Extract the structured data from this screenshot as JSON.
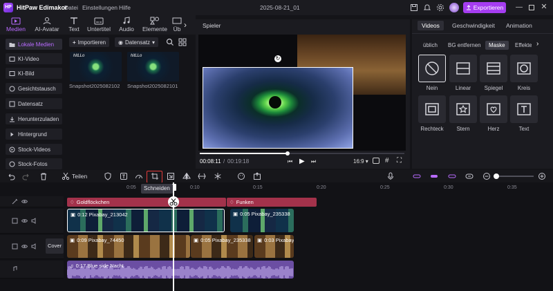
{
  "app": {
    "name": "HitPaw Edimakor",
    "logo_text": "HP",
    "project": "2025-08-21_01",
    "menus": [
      "Datei",
      "Einstellungen",
      "Hilfe"
    ],
    "export_label": "Exportieren",
    "accent": "#a53df0"
  },
  "top_tabs": [
    {
      "label": "Medien",
      "icon": "media-icon",
      "active": true
    },
    {
      "label": "AI-Avatar",
      "icon": "avatar-icon"
    },
    {
      "label": "Text",
      "icon": "text-icon"
    },
    {
      "label": "Untertitel",
      "icon": "subtitle-icon"
    },
    {
      "label": "Audio",
      "icon": "audio-icon"
    },
    {
      "label": "Elemente",
      "icon": "elements-icon"
    },
    {
      "label": "Üb",
      "icon": "transition-icon"
    }
  ],
  "sidebar": {
    "items": [
      "Lokale Medien",
      "KI-Video",
      "KI-Bild",
      "Gesichtstausch",
      "Datensatz",
      "Herunterzuladen",
      "Hintergrund",
      "Stock-Videos",
      "Stock-Fotos"
    ],
    "active": 0
  },
  "media": {
    "import_label": "Importieren",
    "dataset_label": "Datensatz",
    "items": [
      {
        "name": "Snapshot2025082102",
        "overlay_text": "hitLLo"
      },
      {
        "name": "Snapshot2025082101",
        "overlay_text": "hitLLo"
      }
    ]
  },
  "player": {
    "title": "Spieler",
    "current_time": "00:08:11",
    "total_time": "00:19:18",
    "aspect": "16:9",
    "progress": 0.43
  },
  "properties": {
    "tabs": [
      "Videos",
      "Geschwindigkeit",
      "Animation"
    ],
    "active_tab": 0,
    "sub_tabs": [
      "üblich",
      "BG entfernen",
      "Maske",
      "Effekte"
    ],
    "active_sub_tab": 2,
    "masks": [
      {
        "label": "Nein",
        "icon": "none-mask-icon",
        "selected": true
      },
      {
        "label": "Linear",
        "icon": "linear-mask-icon"
      },
      {
        "label": "Spiegel",
        "icon": "mirror-mask-icon"
      },
      {
        "label": "Kreis",
        "icon": "circle-mask-icon"
      },
      {
        "label": "Rechteck",
        "icon": "rectangle-mask-icon"
      },
      {
        "label": "Stern",
        "icon": "star-mask-icon"
      },
      {
        "label": "Herz",
        "icon": "heart-mask-icon"
      },
      {
        "label": "Text",
        "icon": "text-mask-icon"
      }
    ]
  },
  "timeline": {
    "split_label": "Teilen",
    "cut_tooltip": "Schneiden",
    "ruler_ticks": [
      "0:05",
      "0:10",
      "0:15",
      "0:20",
      "0:25",
      "0:30",
      "0:35"
    ],
    "effects": [
      {
        "label": "Goldflöckchen"
      },
      {
        "label": "Funken"
      }
    ],
    "track1": [
      {
        "label": "0:12 Pixabay_213042"
      },
      {
        "label": "0:05 Pixabay_235338"
      }
    ],
    "track2": [
      {
        "label": "0:09 Pixabay_74450"
      },
      {
        "label": "0:05 Pixabay_235338"
      },
      {
        "label": "0:03 Pixabay"
      }
    ],
    "cover_label": "Cover",
    "audio": [
      {
        "label": "0:17 Blue side Nacht"
      }
    ]
  }
}
